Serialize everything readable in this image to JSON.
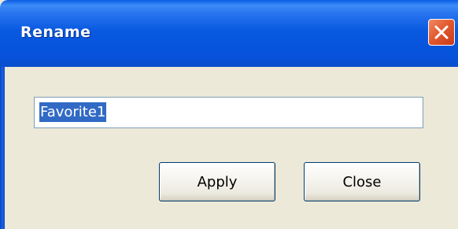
{
  "window": {
    "title": "Rename"
  },
  "form": {
    "name_value": "Favorite1"
  },
  "buttons": {
    "apply_label": "Apply",
    "close_label": "Close"
  },
  "icons": {
    "title_close": "close-icon"
  },
  "colors": {
    "titlebar": "#0a5ae0",
    "close_button": "#e35a2e",
    "dialog_background": "#ece9d8",
    "selection": "#316ac5"
  }
}
